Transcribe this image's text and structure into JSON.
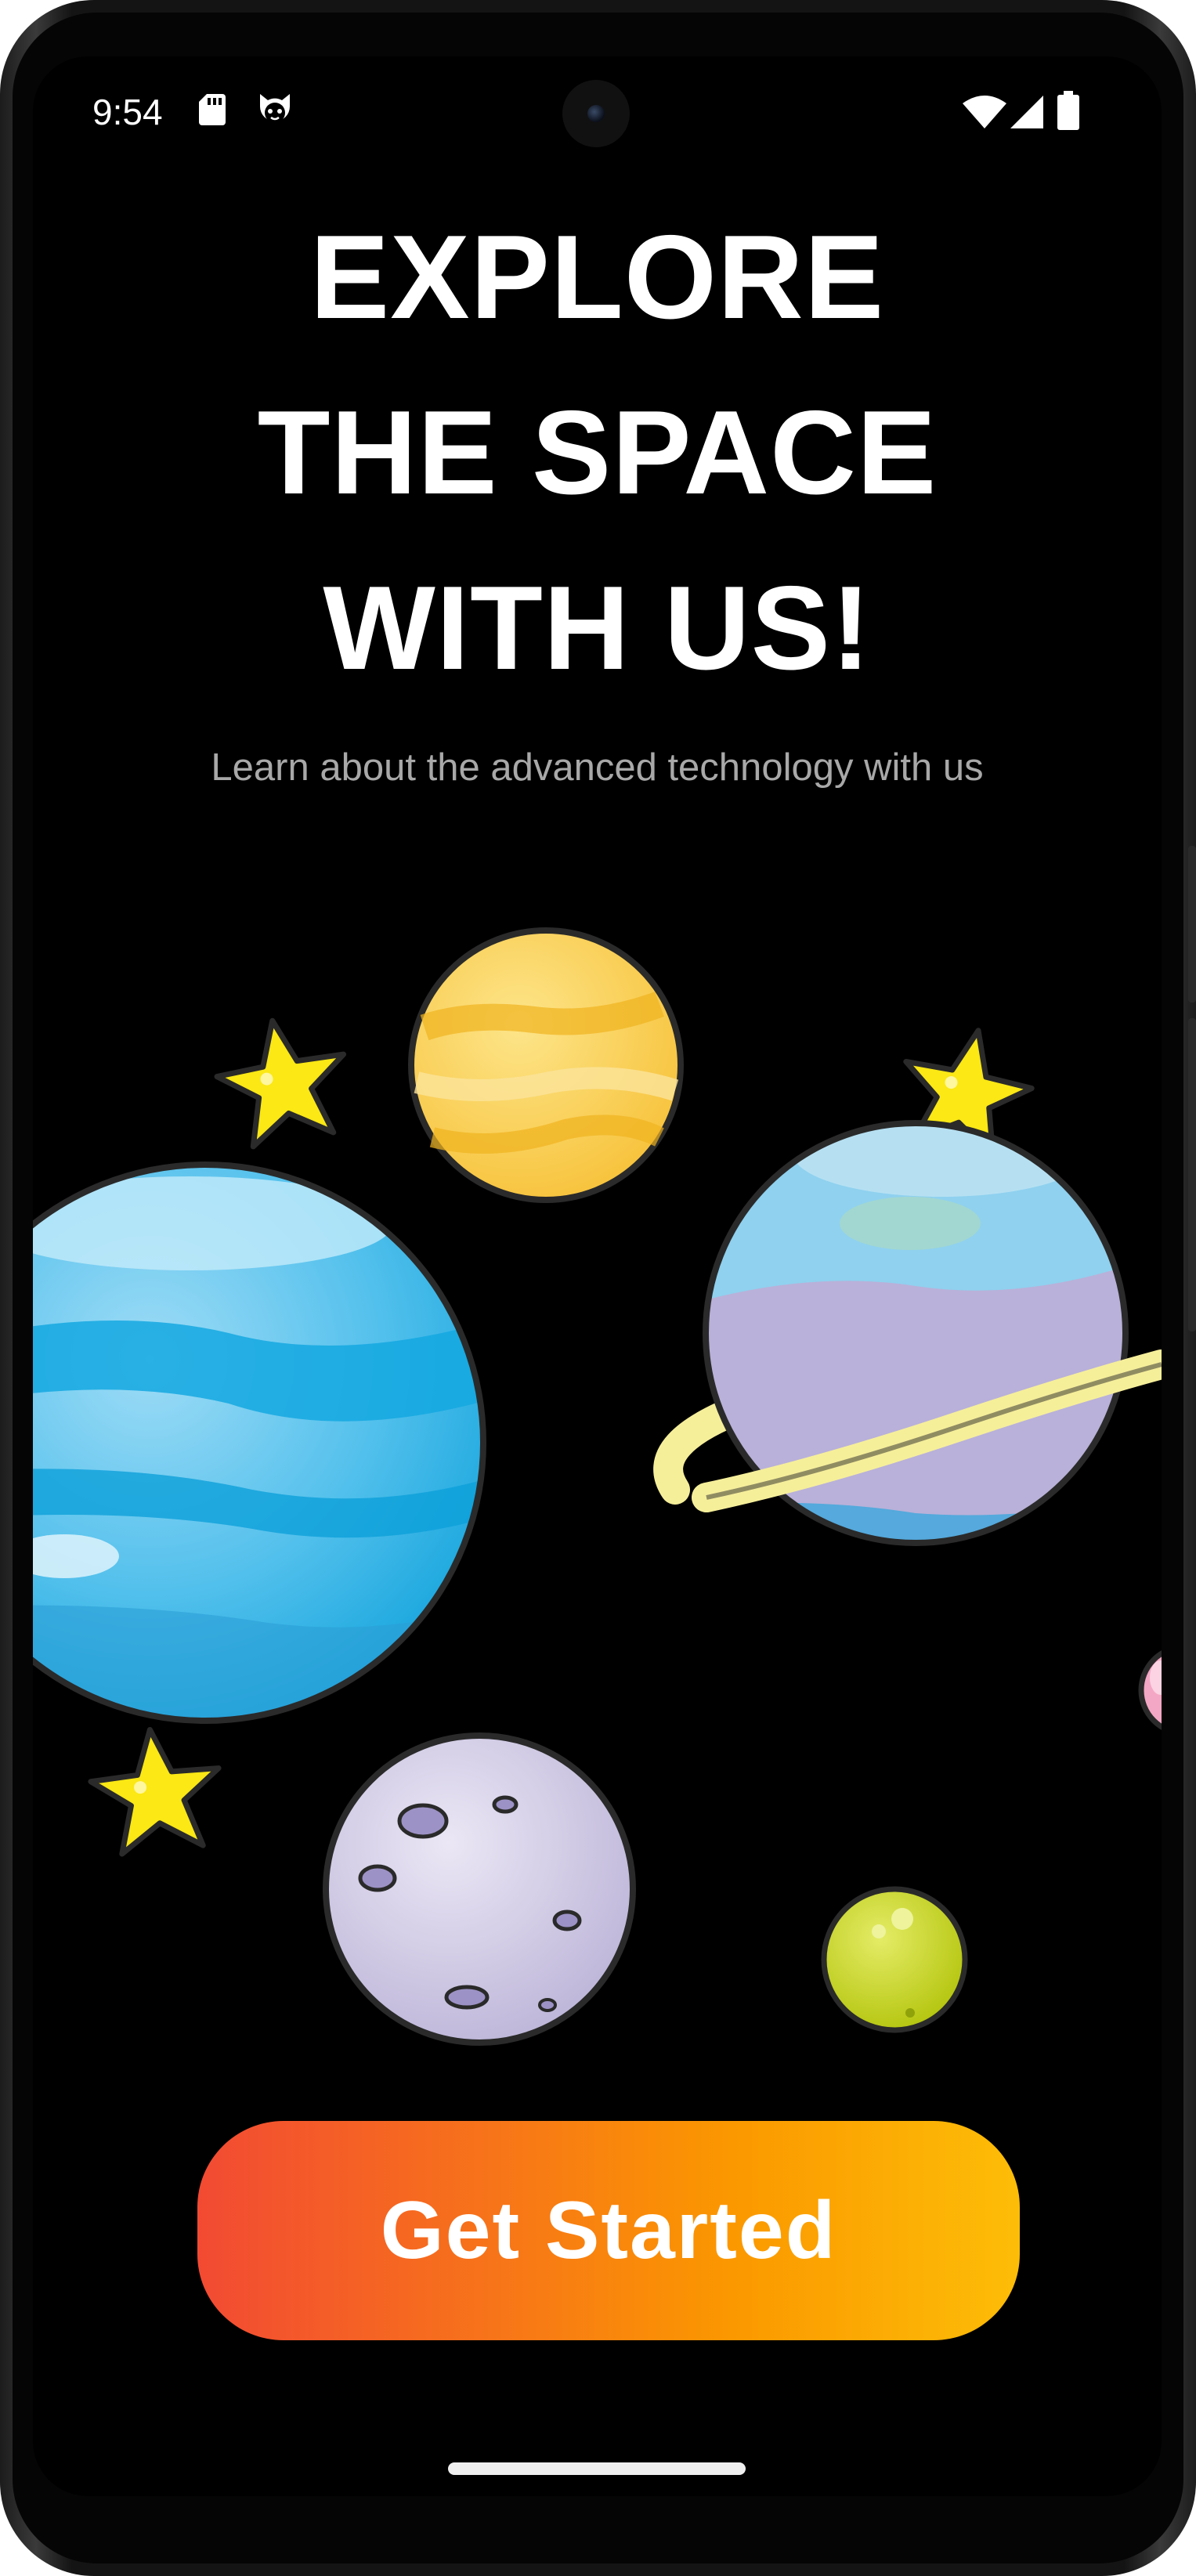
{
  "status_bar": {
    "time": "9:54",
    "left_icons": [
      "sd-card-icon",
      "cat-notification-icon"
    ],
    "right_icons": [
      "wifi-icon",
      "cellular-signal-icon",
      "battery-icon"
    ]
  },
  "onboarding": {
    "headline_lines": [
      "EXPLORE",
      "THE SPACE",
      "WITH US!"
    ],
    "subtitle": "Learn about the advanced technology with us",
    "cta_label": "Get Started"
  },
  "colors": {
    "background": "#000000",
    "headline": "#ffffff",
    "subtitle": "#a8a8a8",
    "cta_gradient_start": "#f24a33",
    "cta_gradient_end": "#fdbd07"
  }
}
